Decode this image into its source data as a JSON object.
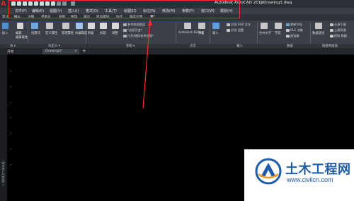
{
  "titlebar": {
    "app_title": "Autodesk AutoCAD 2019",
    "separator": "|",
    "file_name": "Drawing3.dwg",
    "logo": "A"
  },
  "menubar": {
    "items": [
      "文件(F)",
      "编辑(E)",
      "视图(V)",
      "插入(I)",
      "格式(O)",
      "工具(T)",
      "绘图(D)",
      "标注(N)",
      "修改(M)",
      "参数(P)",
      "窗口(W)",
      "帮助(H)"
    ]
  },
  "ribbon_tabs": {
    "items": [
      "默认",
      "插入",
      "注释",
      "参数化",
      "视图",
      "管理",
      "输出",
      "附加模块",
      "协作",
      "精选应用",
      "▣▾"
    ],
    "active": "插入"
  },
  "ribbon": {
    "insert": "插入",
    "edit": "编辑",
    "edit_attr": "编辑属性",
    "create_block": "创建块",
    "define_attr": "定义属性",
    "manage_attr": "管理属性",
    "block_editor": "块编辑器",
    "attach": "附着",
    "clip": "剪裁",
    "adjust": "调整",
    "underlay_layers": "参考底图图层",
    "frames_vary": "*边框可变*",
    "snap_underlay": "打开/捕捉参考底图*",
    "recap": "Autodesk ReCap",
    "import": "附着",
    "import2": "输入",
    "multiline_text": "合并文字",
    "field": "字段",
    "update_fields": "更新字段",
    "ole": "OLE 对象",
    "hyperlink": "超链接",
    "shx_text": "识别 SHX 文字",
    "recognize_settings": "识别 设置",
    "data_link": "数据链接",
    "download_from": "从源下载",
    "upload_to": "上载到源",
    "extract_data": "提取 数据"
  },
  "panel_titles": {
    "block": "块 ▾",
    "block_def": "块定义 ▾",
    "reference": "参照 ▾",
    "point_cloud": "点云",
    "import": "输入",
    "data": "数据",
    "linking": "链接和提取"
  },
  "doc_tabs": {
    "start": "开始",
    "drawing": "Drawing3*",
    "close": "×",
    "add": "+"
  },
  "side_label": "[-][俯视][二维线框]",
  "watermark": {
    "title": "土木工程网",
    "url": "www.civilcn.com"
  },
  "colors": {
    "annotation_red": "#ff2a2a",
    "brand_blue": "#1d5da8",
    "autocad_red": "#d9281e"
  }
}
